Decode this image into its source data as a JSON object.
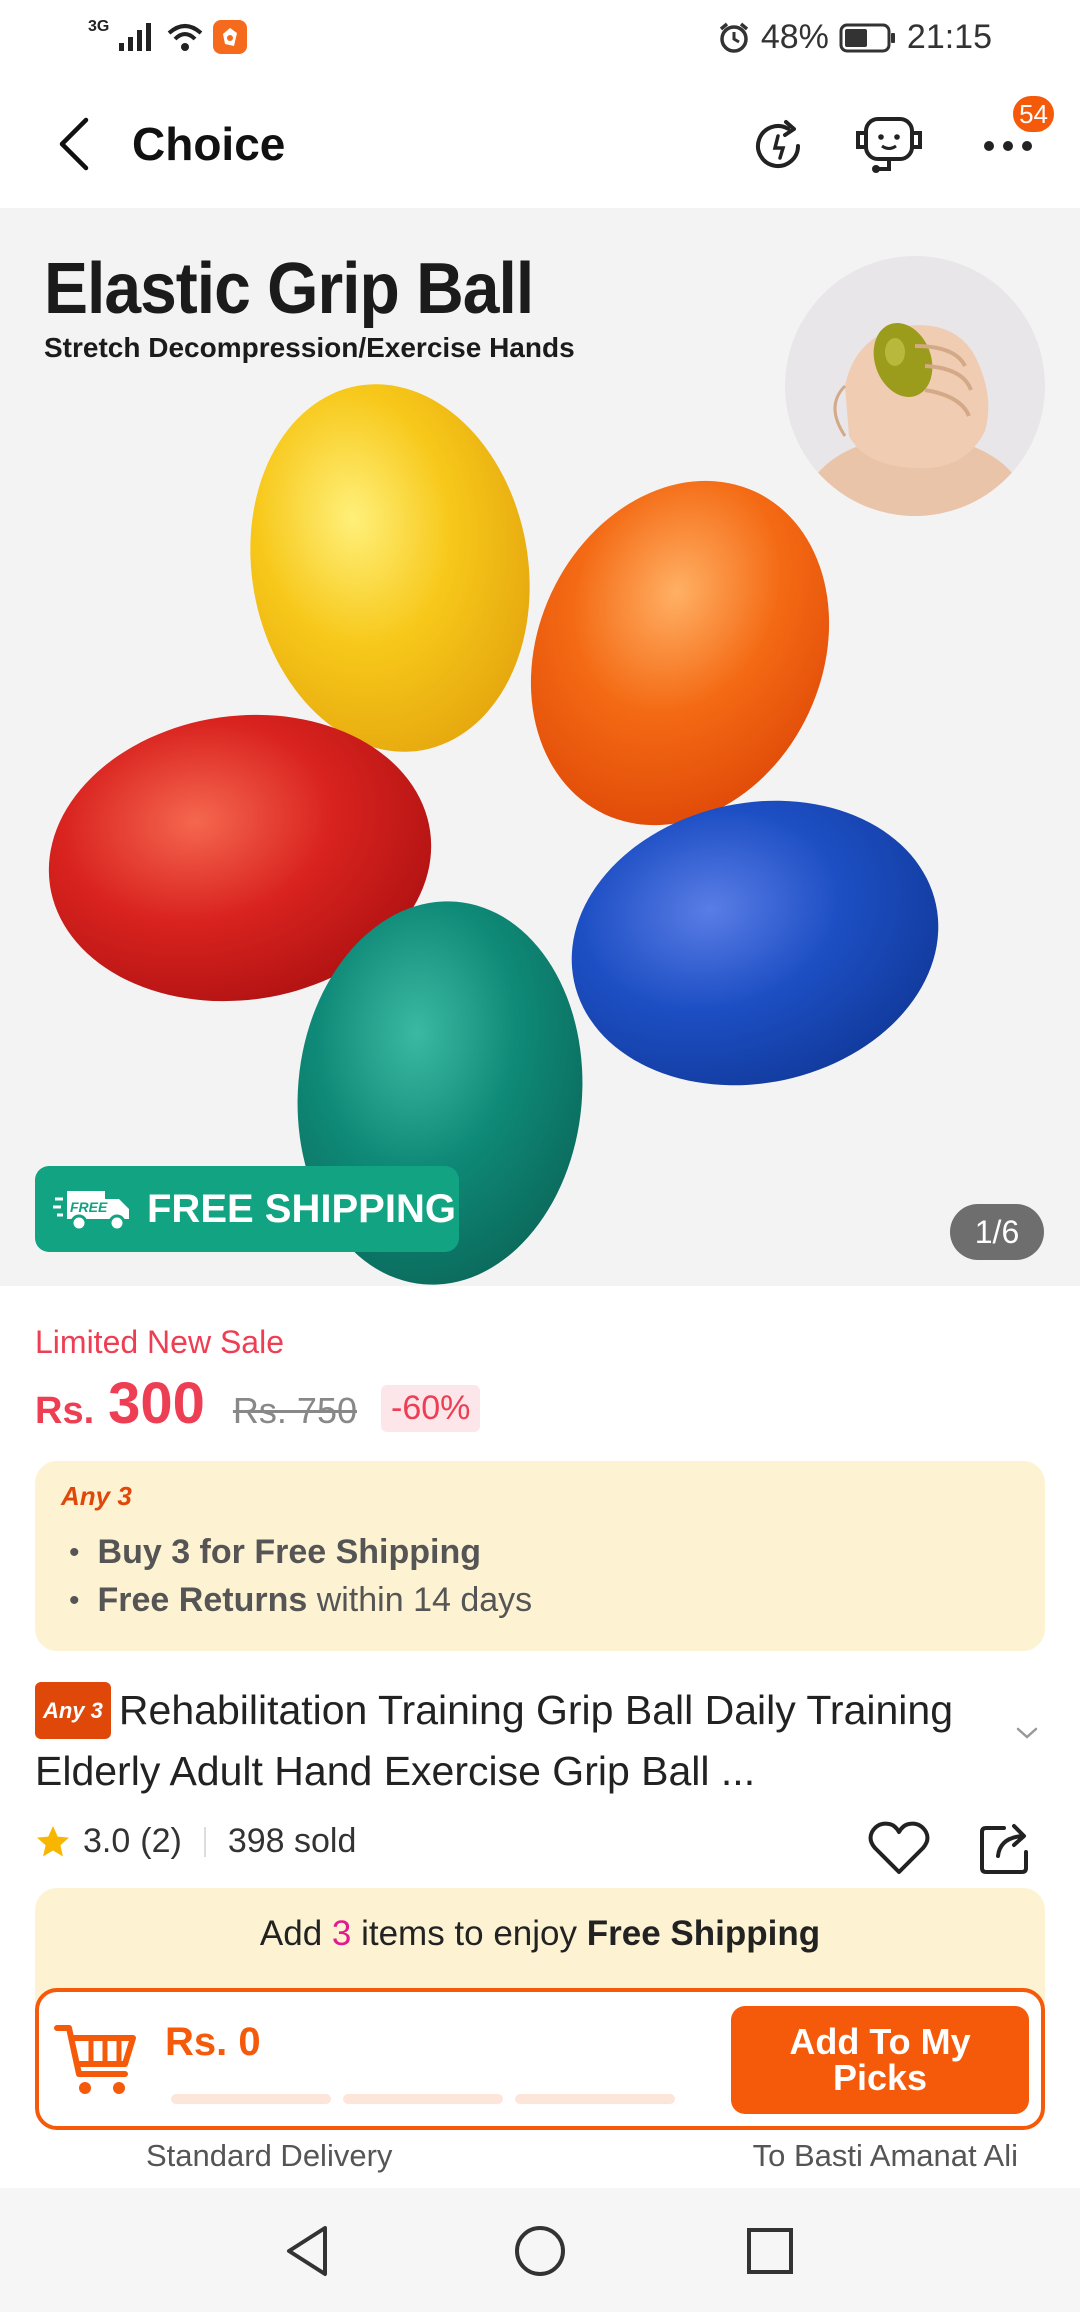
{
  "status_bar": {
    "network": "3G",
    "battery": "48%",
    "time": "21:15"
  },
  "header": {
    "title": "Choice",
    "notification_count": "54"
  },
  "product_image": {
    "title": "Elastic Grip Ball",
    "subtitle": "Stretch Decompression/Exercise Hands",
    "free_shipping_badge_small": "FREE",
    "free_shipping_label": "FREE SHIPPING",
    "counter": "1/6",
    "ball_colors": [
      "#f7c81a",
      "#f46a14",
      "#d9231f",
      "#1d4fc4",
      "#0f8a78"
    ]
  },
  "price": {
    "sale_label": "Limited New Sale",
    "currency": "Rs.",
    "current": "300",
    "original": "Rs. 750",
    "discount": "-60%"
  },
  "promo": {
    "tag": "Any 3",
    "line1_bold": "Buy 3 for  Free Shipping",
    "line2_bold": "Free Returns",
    "line2_rest": " within 14 days"
  },
  "product": {
    "badge": "Any 3",
    "title": "Rehabilitation Training Grip Ball Daily Training Elderly Adult Hand Exercise Grip Ball ...",
    "rating": "3.0",
    "reviews": "(2)",
    "sold": "398 sold"
  },
  "shipping_bar": {
    "prefix": "Add ",
    "count": "3",
    "middle": " items to enjoy ",
    "bold": "Free Shipping",
    "cart_price": "Rs. 0",
    "add_button": "Add To My Picks"
  },
  "delivery": {
    "left": "Standard Delivery",
    "right": "To Basti Amanat Ali"
  },
  "colors": {
    "accent": "#f55a0a",
    "price_red": "#ee3e54",
    "free_ship_green": "#12a383",
    "promo_bg": "#fdf3d3"
  }
}
